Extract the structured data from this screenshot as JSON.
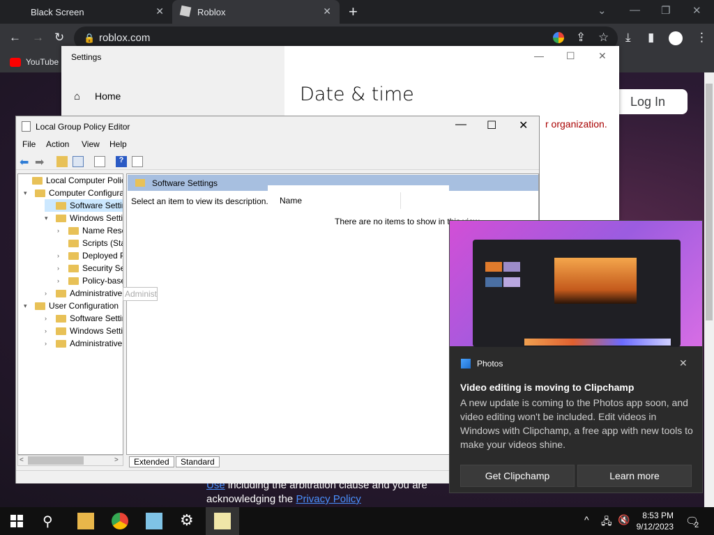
{
  "browser": {
    "tabs": [
      {
        "label": "Black Screen"
      },
      {
        "label": "Roblox"
      }
    ],
    "url": "roblox.com",
    "bookmarks": [
      {
        "label": "YouTube"
      }
    ]
  },
  "roblox": {
    "login_label": "Log In",
    "footer_line1": "Use including the arbitration clause and you are",
    "footer_line1_link": "Use",
    "footer_line1_rest": " including the arbitration clause and you are",
    "footer_line2": "acknowledging the ",
    "privacy_link": "Privacy Policy"
  },
  "settings": {
    "title": "Settings",
    "home": "Home",
    "heading": "Date & time",
    "org_note": "r organization."
  },
  "gpe": {
    "title": "Local Group Policy Editor",
    "menu": [
      "File",
      "Action",
      "View",
      "Help"
    ],
    "tree": [
      {
        "label": "Local Computer Policy",
        "level": 0,
        "expander": ""
      },
      {
        "label": "Computer Configura",
        "level": 1,
        "expander": "v"
      },
      {
        "label": "Software Settings",
        "level": 2,
        "expander": "",
        "selected": true
      },
      {
        "label": "Windows Setting",
        "level": 2,
        "expander": "v"
      },
      {
        "label": "Name Resolu",
        "level": 3,
        "expander": ">"
      },
      {
        "label": "Scripts (Startu",
        "level": 3,
        "expander": ""
      },
      {
        "label": "Deployed Prir",
        "level": 3,
        "expander": ">"
      },
      {
        "label": "Security Settir",
        "level": 3,
        "expander": ">"
      },
      {
        "label": "Policy-based",
        "level": 3,
        "expander": ">"
      },
      {
        "label": "Administrative Te",
        "level": 2,
        "expander": ">"
      },
      {
        "label": "User Configuration",
        "level": 1,
        "expander": "v"
      },
      {
        "label": "Software Settings",
        "level": 2,
        "expander": ">"
      },
      {
        "label": "Windows Setting",
        "level": 2,
        "expander": ">"
      },
      {
        "label": "Administrative Te",
        "level": 2,
        "expander": ">"
      }
    ],
    "tooltip": "Administrative Templates",
    "right_header": "Software Settings",
    "description": "Select an item to view its description.",
    "column_name": "Name",
    "empty_text": "There are no items to show in this view.",
    "tabs": [
      "Extended",
      "Standard"
    ]
  },
  "toast": {
    "app": "Photos",
    "title": "Video editing is moving to Clipchamp",
    "body": "A new update is coming to the Photos app soon, and video editing won't be included. Edit videos in Windows with Clipchamp, a free app with new tools to make your videos shine.",
    "primary": "Get Clipchamp",
    "secondary": "Learn more"
  },
  "taskbar": {
    "time": "8:53 PM",
    "date": "9/12/2023",
    "notifications": "2"
  },
  "colors": {
    "accent": "#0078d4",
    "error_text": "#a80000",
    "tree_selected": "#cce8ff"
  }
}
